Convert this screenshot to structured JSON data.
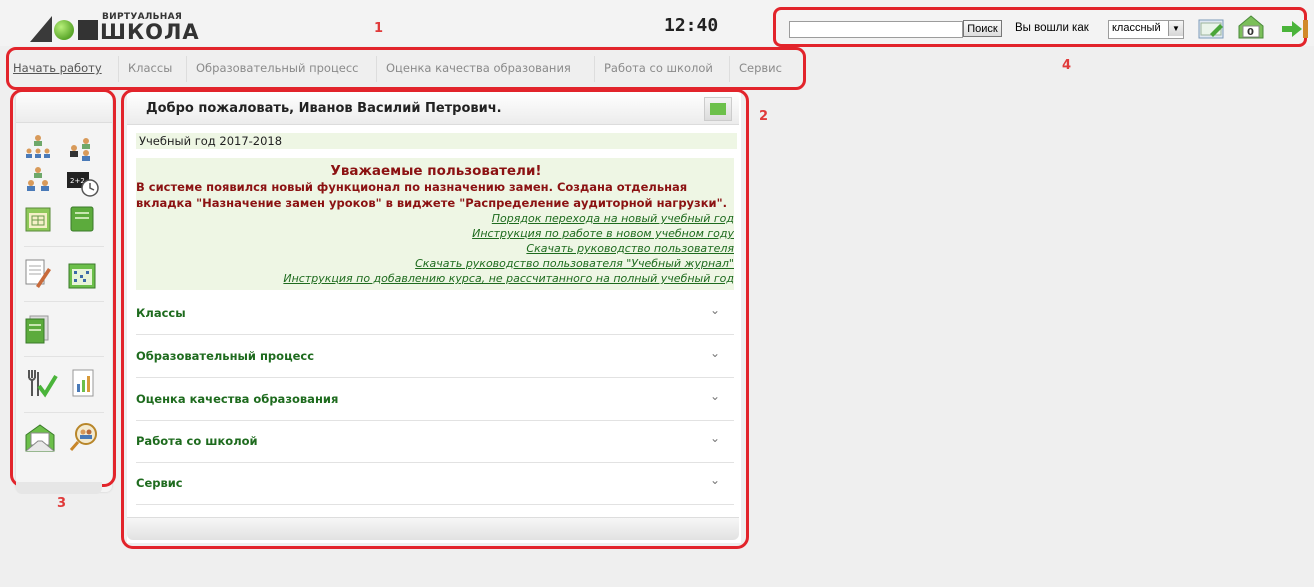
{
  "logo": {
    "small": "ВИРТУАЛЬНАЯ",
    "big": "ШКОЛА"
  },
  "clock": "12:40",
  "annotations": {
    "a1": "1",
    "a2": "2",
    "a3": "3",
    "a4": "4"
  },
  "search": {
    "value": "",
    "button": "Поиск"
  },
  "user": {
    "logged_label": "Вы вошли как",
    "role": "классный"
  },
  "badge": "0",
  "menu": [
    "Начать работу",
    "Классы",
    "Образовательный процесс",
    "Оценка качества образования",
    "Работа со школой",
    "Сервис"
  ],
  "welcome": "Добро пожаловать, Иванов Василий Петрович.",
  "year": "Учебный год 2017-2018",
  "notice": {
    "title": "Уважаемые пользователи!",
    "line1": "В системе появился новый функционал по назначению замен. Создана отдельная",
    "line2": "вкладка \"Назначение замен уроков\" в виджете \"Распределение аудиторной нагрузки\".",
    "links": [
      "Порядок перехода на новый учебный год",
      "Инструкция по работе в новом учебном году",
      "Скачать руководство пользователя",
      "Скачать руководство пользователя \"Учебный журнал\"",
      "Инструкция по добавлению курса, не рассчитанного на полный учебный год"
    ]
  },
  "accordion": [
    "Классы",
    "Образовательный процесс",
    "Оценка качества образования",
    "Работа со школой",
    "Сервис"
  ],
  "icons": {
    "left": [
      "users-hierarchy-icon",
      "user-pair-icon",
      "users-group-icon",
      "schedule-clock-icon",
      "calendar-grid-icon",
      "green-notebook-icon",
      "journal-pen-icon",
      "schedule-table-icon",
      "green-document-icon",
      "fork-check-icon",
      "report-chart-icon",
      "mail-envelope-icon",
      "user-search-icon"
    ]
  },
  "colors": {
    "annotation_red": "#e2242b",
    "link_green": "#1e6b1e",
    "notice_red": "#8b1212",
    "accent_green": "#6cc04a"
  }
}
